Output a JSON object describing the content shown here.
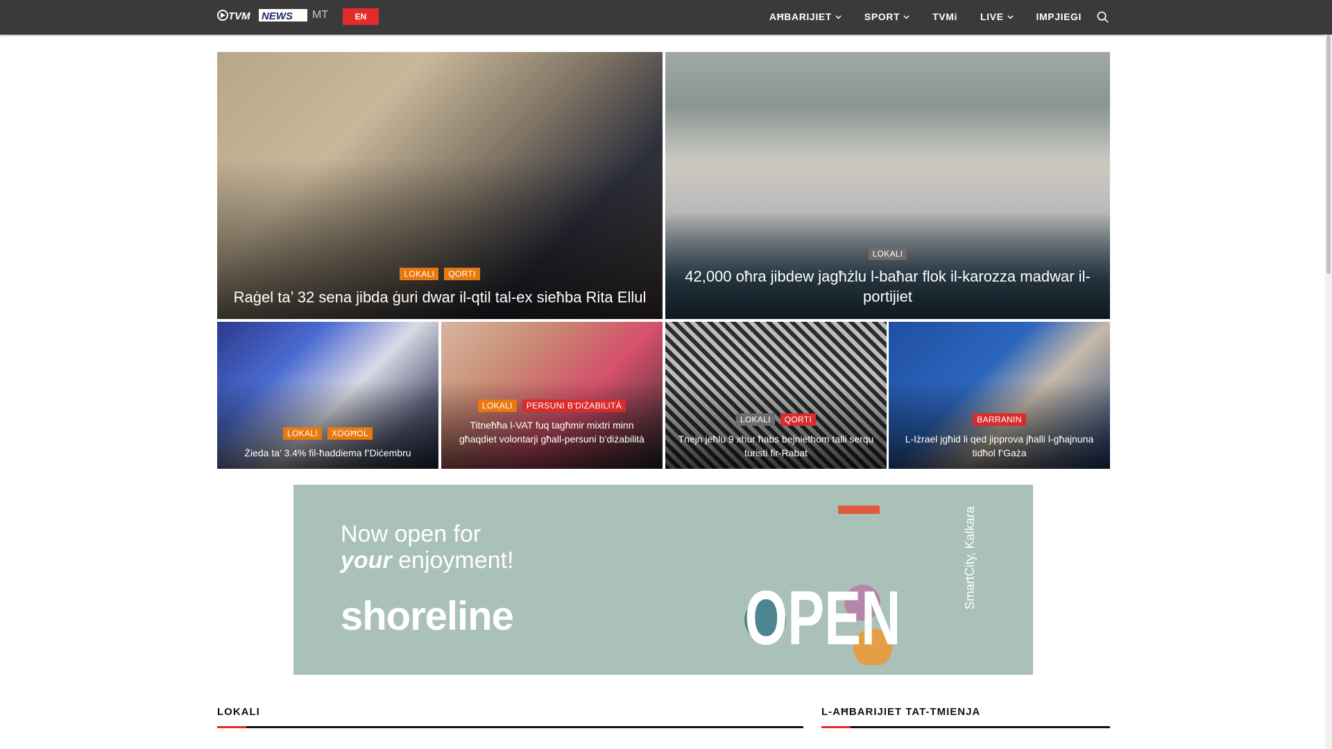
{
  "header": {
    "logo_text": "TVM NEWS",
    "lang_current": "MT",
    "lang_switch": "EN",
    "nav": [
      {
        "label": "AĦBARIJIET",
        "has_dropdown": true
      },
      {
        "label": "SPORT",
        "has_dropdown": true
      },
      {
        "label": "TVMi",
        "has_dropdown": false
      },
      {
        "label": "LIVE",
        "has_dropdown": true
      },
      {
        "label": "IMPJIEGI",
        "has_dropdown": false
      }
    ],
    "search_icon": "search-icon"
  },
  "featured": [
    {
      "categories": [
        {
          "label": "LOKALI",
          "color": "#e8790f"
        },
        {
          "label": "QORTI",
          "color": "#e8790f"
        }
      ],
      "title": "Raġel ta’ 32 sena jibda ġuri dwar il-qtil tal-ex sieħba Rita Ellul"
    },
    {
      "categories": [
        {
          "label": "LOKALI",
          "color": "#6b6b6b"
        }
      ],
      "title": "42,000 oħra jibdew jagħżlu l-baħar flok il-karozza madwar il-portijiet"
    },
    {
      "categories": [
        {
          "label": "LOKALI",
          "color": "#e8790f"
        },
        {
          "label": "XOGĦOL",
          "color": "#e8790f"
        }
      ],
      "title": "Żieda ta’ 3.4% fil-ħaddiema f’Diċembru"
    },
    {
      "categories": [
        {
          "label": "LOKALI",
          "color": "#e8790f"
        },
        {
          "label": "PERSUNI B’DIŻABILITÀ",
          "color": "#d92c2c"
        }
      ],
      "title": "Titneħħa l-VAT fuq tagħmir mixtri minn għaqdiet volontarji għall-persuni b’diżabilità"
    },
    {
      "categories": [
        {
          "label": "LOKALI",
          "color": "#6b6b6b"
        },
        {
          "label": "QORTI",
          "color": "#d92c2c"
        }
      ],
      "title": "Tnejn jeħlu 9 xhur ħabs bejniethom talli serqu turisti fir-Rabat"
    },
    {
      "categories": [
        {
          "label": "BARRANIN",
          "color": "#d92c2c"
        }
      ],
      "title": "L-Iżrael jgħid li qed jipprova jħalli l-għajnuna tidħol f’Gaża"
    }
  ],
  "ad": {
    "line1": "Now open for",
    "line2_bold": "your",
    "line2_rest": " enjoyment!",
    "brand": "shoreline",
    "big_word": "OPEN",
    "location": "SmartCity, Kalkara",
    "colors": {
      "background": "#a9c1b6"
    }
  },
  "sections": [
    {
      "label": "LOKALI"
    },
    {
      "label": "L-AĦBARIJIET TAT-TMIENJA"
    }
  ],
  "colors": {
    "accent": "#e32b2b",
    "header_bg": "#3a3a3a",
    "tag_orange": "#e8790f",
    "tag_red": "#d92c2c"
  }
}
